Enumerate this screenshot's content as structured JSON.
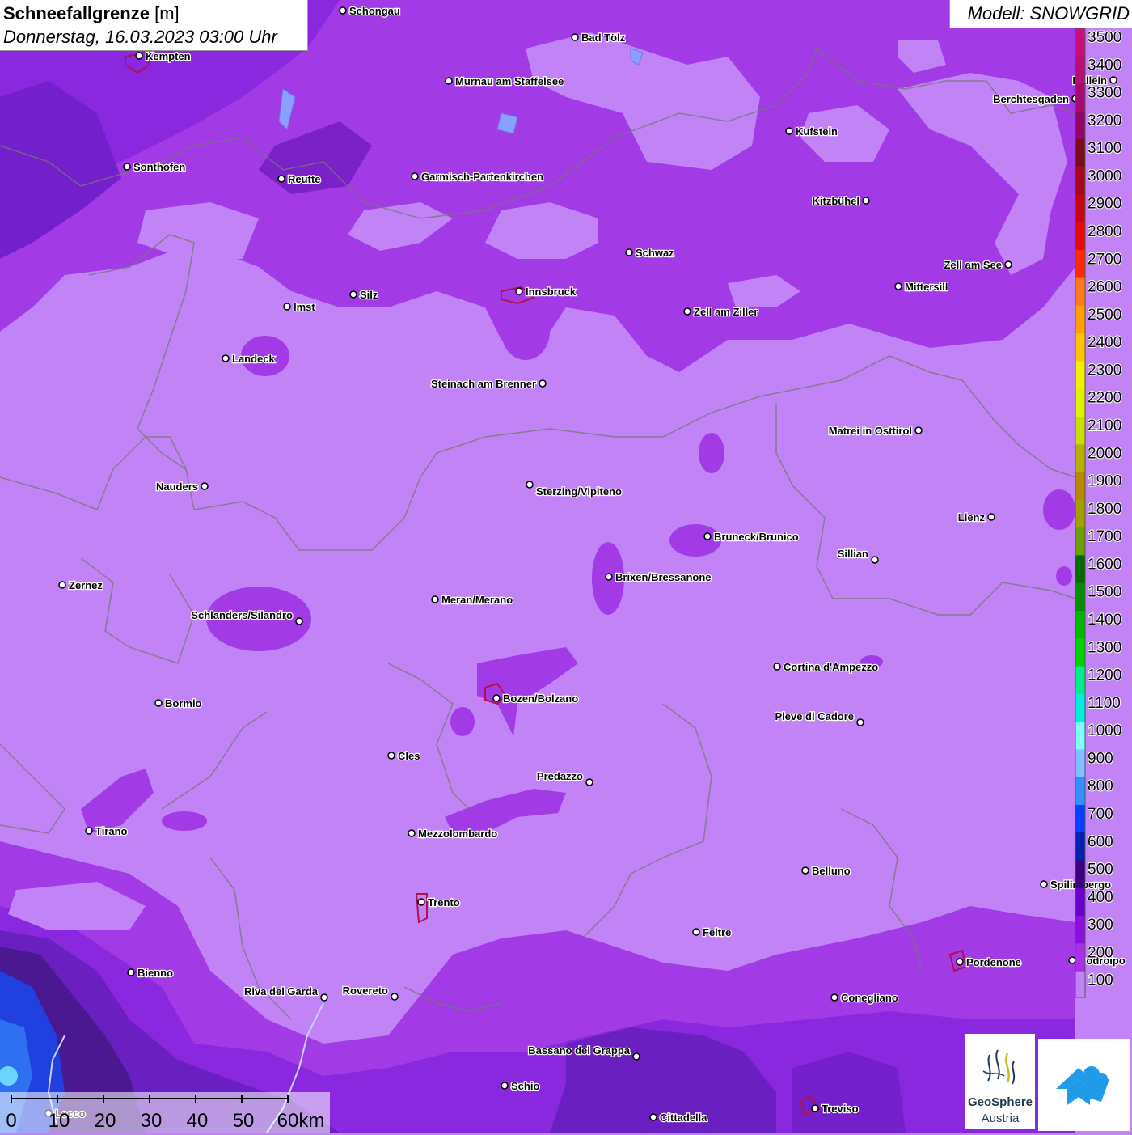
{
  "header": {
    "title": "Schneefallgrenze",
    "unit": "[m]",
    "datetime": "Donnerstag, 16.03.2023 03:00 Uhr"
  },
  "model": {
    "label": "Modell: SNOWGRID"
  },
  "legend": {
    "values": [
      3500,
      3400,
      3300,
      3200,
      3100,
      3000,
      2900,
      2800,
      2700,
      2600,
      2500,
      2400,
      2300,
      2200,
      2100,
      2000,
      1900,
      1800,
      1700,
      1600,
      1500,
      1400,
      1300,
      1200,
      1100,
      1000,
      900,
      800,
      700,
      600,
      500,
      400,
      300,
      200,
      100
    ],
    "colors": [
      "#c8107a",
      "#b90d78",
      "#a80a72",
      "#92066b",
      "#7a0b18",
      "#a8061a",
      "#c70612",
      "#e50b0b",
      "#ff2a07",
      "#ff7a1a",
      "#ff9f00",
      "#ffc400",
      "#f0f000",
      "#dff200",
      "#c8e000",
      "#b8b000",
      "#b88a00",
      "#a0a000",
      "#6b9e00",
      "#006b00",
      "#008f00",
      "#00b800",
      "#00d300",
      "#00f088",
      "#00f0dc",
      "#80ffff",
      "#80c0ff",
      "#3090ff",
      "#0040ff",
      "#0020b0",
      "#3a0080",
      "#6a00d0",
      "#8a10e0",
      "#aa30e8",
      "#c183f5"
    ]
  },
  "cities": [
    {
      "name": "Schongau"
    },
    {
      "name": "Kempten"
    },
    {
      "name": "Bad Tölz"
    },
    {
      "name": "Murnau am Staffelsee"
    },
    {
      "name": "Hallein"
    },
    {
      "name": "Berchtesgaden"
    },
    {
      "name": "Kufstein"
    },
    {
      "name": "Sonthofen"
    },
    {
      "name": "Reutte"
    },
    {
      "name": "Garmisch-Partenkirchen"
    },
    {
      "name": "Kitzbühel"
    },
    {
      "name": "Schwaz"
    },
    {
      "name": "Zell am See"
    },
    {
      "name": "Mittersill"
    },
    {
      "name": "Imst"
    },
    {
      "name": "Silz"
    },
    {
      "name": "Innsbruck"
    },
    {
      "name": "Zell am Ziller"
    },
    {
      "name": "Landeck"
    },
    {
      "name": "Steinach am Brenner"
    },
    {
      "name": "Matrei in Osttirol"
    },
    {
      "name": "Nauders"
    },
    {
      "name": "Sterzing/Vipiteno"
    },
    {
      "name": "Lienz"
    },
    {
      "name": "Bruneck/Brunico"
    },
    {
      "name": "Sillian"
    },
    {
      "name": "Brixen/Bressanone"
    },
    {
      "name": "Zernez"
    },
    {
      "name": "Meran/Merano"
    },
    {
      "name": "Schlanders/Silandro"
    },
    {
      "name": "Cortina d'Ampezzo"
    },
    {
      "name": "Bozen/Bolzano"
    },
    {
      "name": "Bormio"
    },
    {
      "name": "Pieve di Cadore"
    },
    {
      "name": "Cles"
    },
    {
      "name": "Predazzo"
    },
    {
      "name": "Tirano"
    },
    {
      "name": "Mezzolombardo"
    },
    {
      "name": "Belluno"
    },
    {
      "name": "Spilimbergo"
    },
    {
      "name": "Trento"
    },
    {
      "name": "Feltre"
    },
    {
      "name": "Pordenone"
    },
    {
      "name": "Codroipo"
    },
    {
      "name": "Bienno"
    },
    {
      "name": "Riva del Garda"
    },
    {
      "name": "Rovereto"
    },
    {
      "name": "Conegliano"
    },
    {
      "name": "Bassano del Grappa"
    },
    {
      "name": "Schio"
    },
    {
      "name": "Treviso"
    },
    {
      "name": "Cittadella"
    },
    {
      "name": "Lecco"
    }
  ],
  "scale": {
    "labels": [
      "0",
      "10",
      "20",
      "30",
      "40",
      "50",
      "60km"
    ]
  },
  "logos": {
    "geosphere_line1": "GeoSphere",
    "geosphere_line2": "Austria",
    "snowgrid_icon": "snowgrid-cloud-arrow-icon"
  }
}
